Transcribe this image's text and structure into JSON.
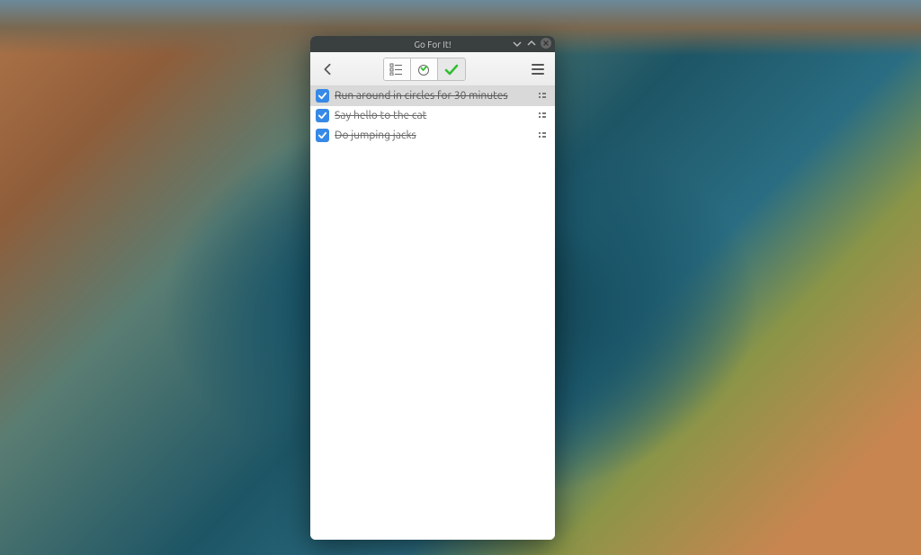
{
  "window": {
    "title": "Go For It!"
  },
  "toolbar": {
    "back": "Back",
    "list": "To-Do",
    "timer": "Timer",
    "done": "Done",
    "menu": "Menu"
  },
  "tasks": [
    {
      "label": "Run around in circles for 30 minutes",
      "checked": true,
      "selected": true
    },
    {
      "label": "Say hello to the cat",
      "checked": true,
      "selected": false
    },
    {
      "label": "Do jumping jacks",
      "checked": true,
      "selected": false
    }
  ],
  "colors": {
    "accent": "#3689e6",
    "check_green": "#2fbf2f"
  }
}
